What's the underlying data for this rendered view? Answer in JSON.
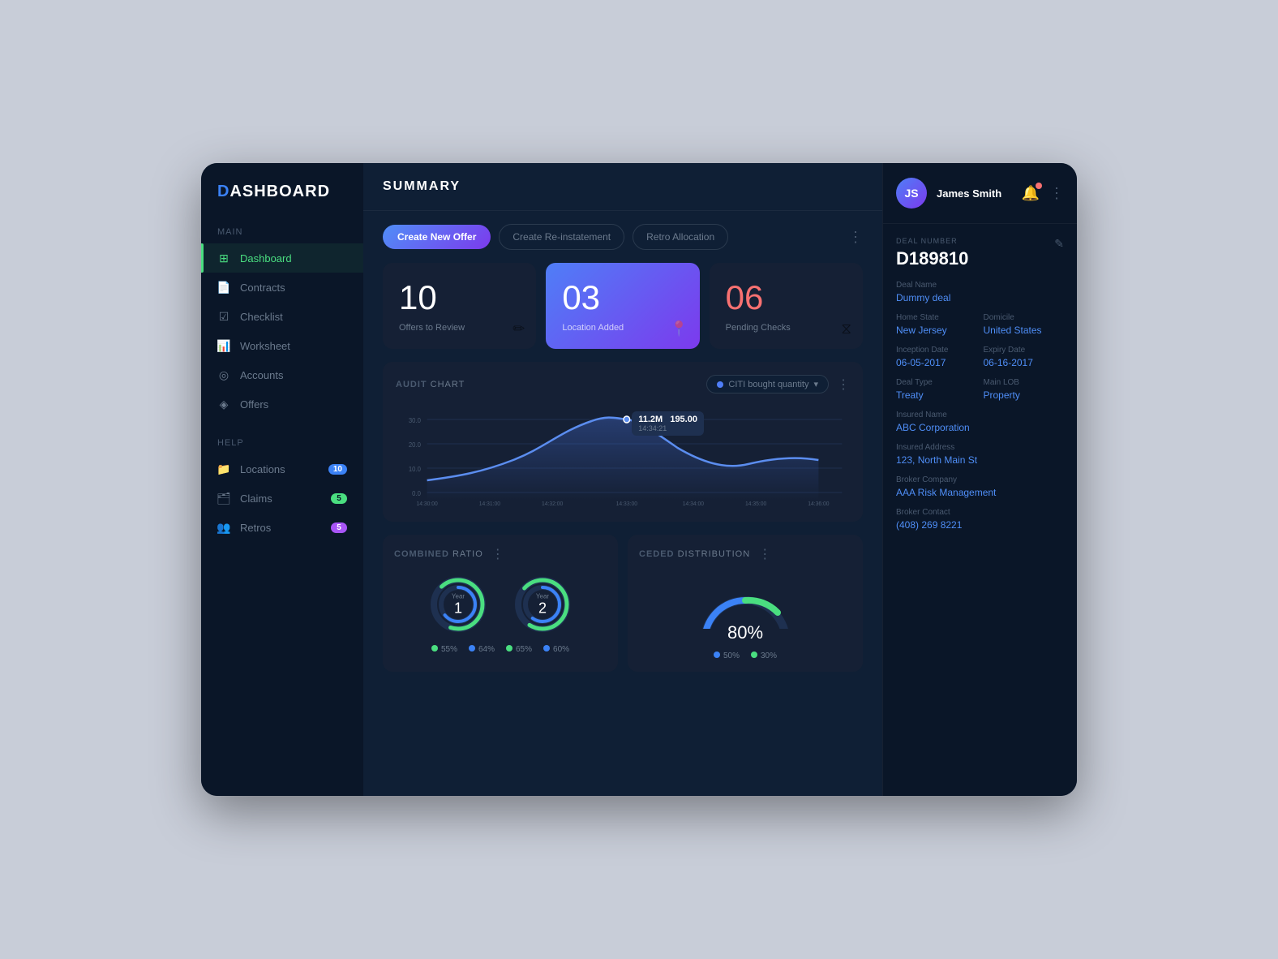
{
  "sidebar": {
    "logo": {
      "accent": "D",
      "rest": "ASHBOARD"
    },
    "sections": [
      {
        "label": "Main",
        "items": [
          {
            "id": "dashboard",
            "label": "Dashboard",
            "icon": "⊞",
            "active": true,
            "badge": null
          },
          {
            "id": "contracts",
            "label": "Contracts",
            "icon": "📄",
            "active": false,
            "badge": null
          },
          {
            "id": "checklist",
            "label": "Checklist",
            "icon": "☑",
            "active": false,
            "badge": null
          },
          {
            "id": "worksheet",
            "label": "Worksheet",
            "icon": "📊",
            "active": false,
            "badge": null
          },
          {
            "id": "accounts",
            "label": "Accounts",
            "icon": "◎",
            "active": false,
            "badge": null
          },
          {
            "id": "offers",
            "label": "Offers",
            "icon": "◈",
            "active": false,
            "badge": null
          }
        ]
      },
      {
        "label": "Help",
        "items": [
          {
            "id": "locations",
            "label": "Locations",
            "icon": "📁",
            "active": false,
            "badge": "10",
            "badge_type": "blue"
          },
          {
            "id": "claims",
            "label": "Claims",
            "icon": "🗂",
            "active": false,
            "badge": "5",
            "badge_type": "green"
          },
          {
            "id": "retros",
            "label": "Retros",
            "icon": "👥",
            "active": false,
            "badge": "5",
            "badge_type": "purple"
          }
        ]
      }
    ]
  },
  "header": {
    "title": "SUMMARY"
  },
  "action_bar": {
    "buttons": [
      {
        "id": "create-offer",
        "label": "Create New Offer",
        "type": "primary"
      },
      {
        "id": "create-reinstatement",
        "label": "Create Re-instatement",
        "type": "outline"
      },
      {
        "id": "retro-allocation",
        "label": "Retro Allocation",
        "type": "outline"
      }
    ]
  },
  "stat_cards": [
    {
      "id": "offers",
      "value": "10",
      "label": "Offers to Review",
      "highlighted": false,
      "value_color": "white",
      "icon": "✏"
    },
    {
      "id": "location",
      "value": "03",
      "label": "Location Added",
      "highlighted": true,
      "value_color": "white",
      "icon": "📍"
    },
    {
      "id": "pending",
      "value": "06",
      "label": "Pending Checks",
      "highlighted": false,
      "value_color": "red",
      "icon": "⧖"
    }
  ],
  "audit_chart": {
    "title": "AUDIT",
    "title_span": "CHART",
    "filter_label": "CITI bought quantity",
    "tooltip": {
      "value": "11.2M",
      "extra": "195.00",
      "sub": "14:34:21"
    },
    "y_axis": [
      "30.0",
      "20.0",
      "10.0",
      "0.0"
    ],
    "x_axis": [
      "14:30:00",
      "14:31:00",
      "14:32:00",
      "14:33:00",
      "14:34:00",
      "14:35:00",
      "14:36:00"
    ]
  },
  "combined_ratio": {
    "title": "COMBINED",
    "title_span": "RATIO",
    "year1": {
      "label": "Year",
      "number": "1",
      "ring1_pct": 55,
      "ring2_pct": 64,
      "ring1_color": "#4ade80",
      "ring2_color": "#3b82f6"
    },
    "year2": {
      "label": "Year",
      "number": "2",
      "ring1_pct": 65,
      "ring2_pct": 60,
      "ring1_color": "#4ade80",
      "ring2_color": "#3b82f6"
    },
    "legend": [
      {
        "color": "#4ade80",
        "label": "55%"
      },
      {
        "color": "#3b82f6",
        "label": "64%"
      },
      {
        "color": "#4ade80",
        "label": "65%"
      },
      {
        "color": "#3b82f6",
        "label": "60%"
      }
    ]
  },
  "ceded_distribution": {
    "title": "CEDED",
    "title_span": "DISTRIBUTION",
    "gauge_value": "80%",
    "gauge_pct": 80,
    "legend": [
      {
        "color": "#3b82f6",
        "label": "50%"
      },
      {
        "color": "#4ade80",
        "label": "30%"
      }
    ]
  },
  "right_panel": {
    "user": {
      "name": "James Smith",
      "initials": "JS"
    },
    "deal_number_label": "DEAL NUMBER",
    "deal_number": "D189810",
    "fields": [
      {
        "label": "Deal Name",
        "value": "Dummy deal",
        "row": false
      },
      {
        "label": "Home State",
        "value": "New Jersey",
        "row": true,
        "col": 1
      },
      {
        "label": "Domicile",
        "value": "United States",
        "row": true,
        "col": 2
      },
      {
        "label": "Inception Date",
        "value": "06-05-2017",
        "row": true,
        "col": 1
      },
      {
        "label": "Expiry Date",
        "value": "06-16-2017",
        "row": true,
        "col": 2
      },
      {
        "label": "Deal Type",
        "value": "Treaty",
        "row": true,
        "col": 1
      },
      {
        "label": "Main LOB",
        "value": "Property",
        "row": true,
        "col": 2
      },
      {
        "label": "Insured Name",
        "value": "ABC Corporation",
        "row": false
      },
      {
        "label": "Insured Address",
        "value": "123, North Main St",
        "row": false
      },
      {
        "label": "Broker Company",
        "value": "AAA Risk Management",
        "row": false
      },
      {
        "label": "Broker Contact",
        "value": "(408) 269 8221",
        "row": false
      }
    ]
  }
}
